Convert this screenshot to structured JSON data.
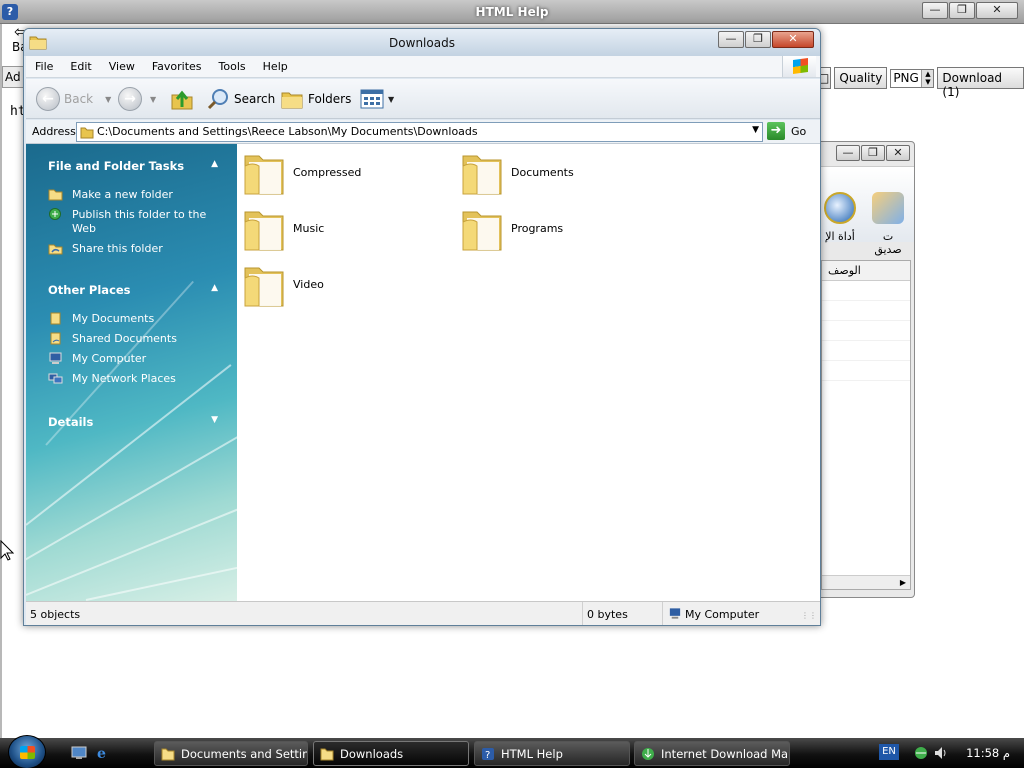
{
  "help_window": {
    "title": "HTML Help",
    "toolbar_fragment": "Ba",
    "address_fragment": "Ad",
    "content_fragment": "ht",
    "quality_label": "Quality",
    "quality_value": "PNG",
    "download_button": "Download (1)"
  },
  "idm_window": {
    "icon_labels": [
      "أداة الإ",
      "ت صديق"
    ],
    "list_header": "الوصف"
  },
  "explorer": {
    "title": "Downloads",
    "menu": [
      "File",
      "Edit",
      "View",
      "Favorites",
      "Tools",
      "Help"
    ],
    "toolbar": {
      "back": "Back",
      "search": "Search",
      "folders": "Folders"
    },
    "address": {
      "label": "Address",
      "path": "C:\\Documents and Settings\\Reece Labson\\My Documents\\Downloads",
      "go": "Go"
    },
    "task_pane": {
      "file_tasks": {
        "header": "File and Folder Tasks",
        "links": [
          "Make a new folder",
          "Publish this folder to the Web",
          "Share this folder"
        ]
      },
      "other_places": {
        "header": "Other Places",
        "links": [
          "My Documents",
          "Shared Documents",
          "My Computer",
          "My Network Places"
        ]
      },
      "details": {
        "header": "Details"
      }
    },
    "folders": [
      "Compressed",
      "Documents",
      "Music",
      "Programs",
      "Video"
    ],
    "status": {
      "objects": "5 objects",
      "size": "0 bytes",
      "location": "My Computer"
    }
  },
  "taskbar": {
    "buttons": [
      "Documents and Settings",
      "Downloads",
      "HTML Help",
      "Internet Download Ma..."
    ],
    "active_index": 1,
    "language": "EN",
    "clock": "11:58 م"
  },
  "colors": {
    "folder_yellow": "#f3d36b",
    "task_pane_top": "#1b6a8d",
    "task_pane_bottom": "#d7efe6"
  }
}
